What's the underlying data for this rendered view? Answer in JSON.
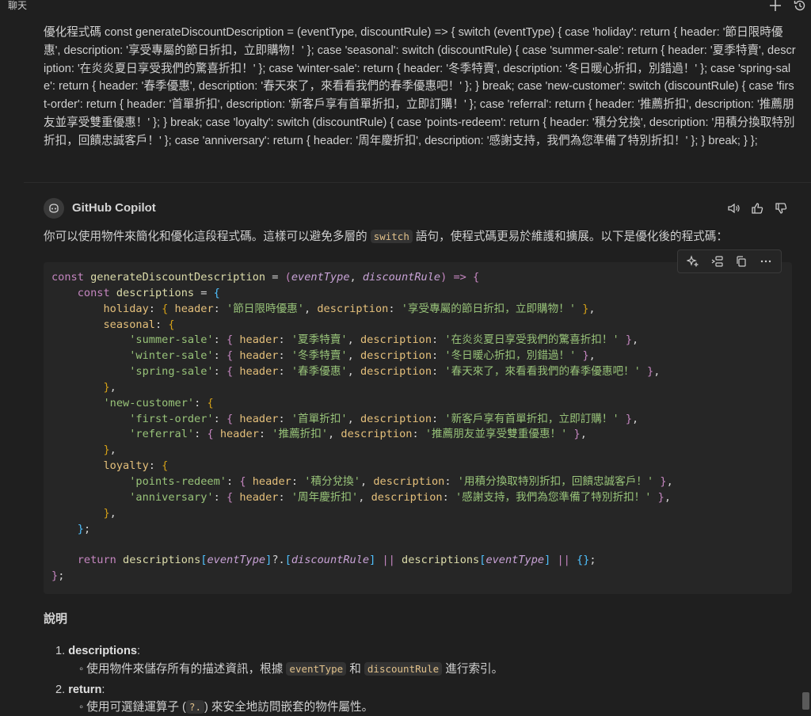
{
  "topbar": {
    "title": "聊天",
    "new_icon": "plus-icon",
    "history_icon": "history-icon"
  },
  "user_message": "優化程式碼 const generateDiscountDescription = (eventType, discountRule) => { switch (eventType) { case 'holiday': return { header: '節日限時優惠', description: '享受專屬的節日折扣，立即購物！' }; case 'seasonal': switch (discountRule) { case 'summer-sale': return { header: '夏季特賣', description: '在炎炎夏日享受我們的驚喜折扣！' }; case 'winter-sale': return { header: '冬季特賣', description: '冬日暖心折扣，別錯過！' }; case 'spring-sale': return { header: '春季優惠', description: '春天來了，來看看我們的春季優惠吧！' }; } break; case 'new-customer': switch (discountRule) { case 'first-order': return { header: '首單折扣', description: '新客戶享有首單折扣，立即訂購！' }; case 'referral': return { header: '推薦折扣', description: '推薦朋友並享受雙重優惠！' }; } break; case 'loyalty': switch (discountRule) { case 'points-redeem': return { header: '積分兌換', description: '用積分換取特別折扣，回饋忠誠客戶！' }; case 'anniversary': return { header: '周年慶折扣', description: '感謝支持，我們為您準備了特別折扣！' }; } break; } };",
  "bot": {
    "name": "GitHub Copilot",
    "icons": [
      "speaker-icon",
      "thumbs-up-icon",
      "thumbs-down-icon"
    ]
  },
  "intro": {
    "before": "你可以使用物件來簡化和優化這段程式碼。這樣可以避免多層的",
    "code": "switch",
    "after": "語句，使程式碼更易於維護和擴展。以下是優化後的程式碼："
  },
  "code_toolbar": [
    "sparkle-icon",
    "insert-icon",
    "copy-icon",
    "more-icon"
  ],
  "code": {
    "language": "javascript",
    "lines": [
      [
        [
          "kw",
          "const "
        ],
        [
          "fn",
          "generateDiscountDescription"
        ],
        [
          "pun",
          " = "
        ],
        [
          "brk2",
          "("
        ],
        [
          "param",
          "eventType"
        ],
        [
          "pun",
          ", "
        ],
        [
          "param",
          "discountRule"
        ],
        [
          "brk2",
          ")"
        ],
        [
          "pun",
          " "
        ],
        [
          "op",
          "=>"
        ],
        [
          "pun",
          " "
        ],
        [
          "brk2",
          "{"
        ]
      ],
      [
        [
          "pun",
          "    "
        ],
        [
          "kw",
          "const "
        ],
        [
          "var",
          "descriptions"
        ],
        [
          "pun",
          " = "
        ],
        [
          "brk3",
          "{"
        ]
      ],
      [
        [
          "pun",
          "        "
        ],
        [
          "prop",
          "holiday"
        ],
        [
          "pun",
          ": "
        ],
        [
          "brk",
          "{ "
        ],
        [
          "prop",
          "header"
        ],
        [
          "pun",
          ": "
        ],
        [
          "str",
          "'節日限時優惠'"
        ],
        [
          "pun",
          ", "
        ],
        [
          "prop",
          "description"
        ],
        [
          "pun",
          ": "
        ],
        [
          "str",
          "'享受專屬的節日折扣，立即購物！'"
        ],
        [
          "pun",
          " "
        ],
        [
          "brk",
          "}"
        ],
        [
          "pun",
          ","
        ]
      ],
      [
        [
          "pun",
          "        "
        ],
        [
          "prop",
          "seasonal"
        ],
        [
          "pun",
          ": "
        ],
        [
          "brk",
          "{"
        ]
      ],
      [
        [
          "pun",
          "            "
        ],
        [
          "str",
          "'summer-sale'"
        ],
        [
          "pun",
          ": "
        ],
        [
          "brk2",
          "{ "
        ],
        [
          "prop",
          "header"
        ],
        [
          "pun",
          ": "
        ],
        [
          "str",
          "'夏季特賣'"
        ],
        [
          "pun",
          ", "
        ],
        [
          "prop",
          "description"
        ],
        [
          "pun",
          ": "
        ],
        [
          "str",
          "'在炎炎夏日享受我們的驚喜折扣！'"
        ],
        [
          "pun",
          " "
        ],
        [
          "brk2",
          "}"
        ],
        [
          "pun",
          ","
        ]
      ],
      [
        [
          "pun",
          "            "
        ],
        [
          "str",
          "'winter-sale'"
        ],
        [
          "pun",
          ": "
        ],
        [
          "brk2",
          "{ "
        ],
        [
          "prop",
          "header"
        ],
        [
          "pun",
          ": "
        ],
        [
          "str",
          "'冬季特賣'"
        ],
        [
          "pun",
          ", "
        ],
        [
          "prop",
          "description"
        ],
        [
          "pun",
          ": "
        ],
        [
          "str",
          "'冬日暖心折扣，別錯過！'"
        ],
        [
          "pun",
          " "
        ],
        [
          "brk2",
          "}"
        ],
        [
          "pun",
          ","
        ]
      ],
      [
        [
          "pun",
          "            "
        ],
        [
          "str",
          "'spring-sale'"
        ],
        [
          "pun",
          ": "
        ],
        [
          "brk2",
          "{ "
        ],
        [
          "prop",
          "header"
        ],
        [
          "pun",
          ": "
        ],
        [
          "str",
          "'春季優惠'"
        ],
        [
          "pun",
          ", "
        ],
        [
          "prop",
          "description"
        ],
        [
          "pun",
          ": "
        ],
        [
          "str",
          "'春天來了，來看看我們的春季優惠吧！'"
        ],
        [
          "pun",
          " "
        ],
        [
          "brk2",
          "}"
        ],
        [
          "pun",
          ","
        ]
      ],
      [
        [
          "pun",
          "        "
        ],
        [
          "brk",
          "}"
        ],
        [
          "pun",
          ","
        ]
      ],
      [
        [
          "pun",
          "        "
        ],
        [
          "str",
          "'new-customer'"
        ],
        [
          "pun",
          ": "
        ],
        [
          "brk",
          "{"
        ]
      ],
      [
        [
          "pun",
          "            "
        ],
        [
          "str",
          "'first-order'"
        ],
        [
          "pun",
          ": "
        ],
        [
          "brk2",
          "{ "
        ],
        [
          "prop",
          "header"
        ],
        [
          "pun",
          ": "
        ],
        [
          "str",
          "'首單折扣'"
        ],
        [
          "pun",
          ", "
        ],
        [
          "prop",
          "description"
        ],
        [
          "pun",
          ": "
        ],
        [
          "str",
          "'新客戶享有首單折扣，立即訂購！'"
        ],
        [
          "pun",
          " "
        ],
        [
          "brk2",
          "}"
        ],
        [
          "pun",
          ","
        ]
      ],
      [
        [
          "pun",
          "            "
        ],
        [
          "str",
          "'referral'"
        ],
        [
          "pun",
          ": "
        ],
        [
          "brk2",
          "{ "
        ],
        [
          "prop",
          "header"
        ],
        [
          "pun",
          ": "
        ],
        [
          "str",
          "'推薦折扣'"
        ],
        [
          "pun",
          ", "
        ],
        [
          "prop",
          "description"
        ],
        [
          "pun",
          ": "
        ],
        [
          "str",
          "'推薦朋友並享受雙重優惠！'"
        ],
        [
          "pun",
          " "
        ],
        [
          "brk2",
          "}"
        ],
        [
          "pun",
          ","
        ]
      ],
      [
        [
          "pun",
          "        "
        ],
        [
          "brk",
          "}"
        ],
        [
          "pun",
          ","
        ]
      ],
      [
        [
          "pun",
          "        "
        ],
        [
          "prop",
          "loyalty"
        ],
        [
          "pun",
          ": "
        ],
        [
          "brk",
          "{"
        ]
      ],
      [
        [
          "pun",
          "            "
        ],
        [
          "str",
          "'points-redeem'"
        ],
        [
          "pun",
          ": "
        ],
        [
          "brk2",
          "{ "
        ],
        [
          "prop",
          "header"
        ],
        [
          "pun",
          ": "
        ],
        [
          "str",
          "'積分兌換'"
        ],
        [
          "pun",
          ", "
        ],
        [
          "prop",
          "description"
        ],
        [
          "pun",
          ": "
        ],
        [
          "str",
          "'用積分換取特別折扣，回饋忠誠客戶！'"
        ],
        [
          "pun",
          " "
        ],
        [
          "brk2",
          "}"
        ],
        [
          "pun",
          ","
        ]
      ],
      [
        [
          "pun",
          "            "
        ],
        [
          "str",
          "'anniversary'"
        ],
        [
          "pun",
          ": "
        ],
        [
          "brk2",
          "{ "
        ],
        [
          "prop",
          "header"
        ],
        [
          "pun",
          ": "
        ],
        [
          "str",
          "'周年慶折扣'"
        ],
        [
          "pun",
          ", "
        ],
        [
          "prop",
          "description"
        ],
        [
          "pun",
          ": "
        ],
        [
          "str",
          "'感謝支持，我們為您準備了特別折扣！'"
        ],
        [
          "pun",
          " "
        ],
        [
          "brk2",
          "}"
        ],
        [
          "pun",
          ","
        ]
      ],
      [
        [
          "pun",
          "        "
        ],
        [
          "brk",
          "}"
        ],
        [
          "pun",
          ","
        ]
      ],
      [
        [
          "pun",
          "    "
        ],
        [
          "brk3",
          "}"
        ],
        [
          "pun",
          ";"
        ]
      ],
      [
        [
          "pun",
          ""
        ]
      ],
      [
        [
          "pun",
          "    "
        ],
        [
          "kw",
          "return "
        ],
        [
          "var",
          "descriptions"
        ],
        [
          "brk3",
          "["
        ],
        [
          "param",
          "eventType"
        ],
        [
          "brk3",
          "]"
        ],
        [
          "pun",
          "?."
        ],
        [
          "brk3",
          "["
        ],
        [
          "param",
          "discountRule"
        ],
        [
          "brk3",
          "]"
        ],
        [
          "pun",
          " "
        ],
        [
          "op",
          "||"
        ],
        [
          "pun",
          " "
        ],
        [
          "var",
          "descriptions"
        ],
        [
          "brk3",
          "["
        ],
        [
          "param",
          "eventType"
        ],
        [
          "brk3",
          "]"
        ],
        [
          "pun",
          " "
        ],
        [
          "op",
          "||"
        ],
        [
          "pun",
          " "
        ],
        [
          "brk3",
          "{}"
        ],
        [
          "pun",
          ";"
        ]
      ],
      [
        [
          "brk2",
          "}"
        ],
        [
          "pun",
          ";"
        ]
      ]
    ]
  },
  "explanation": {
    "title": "說明",
    "items": [
      {
        "num": "1.",
        "term": "descriptions",
        "colon": ":",
        "sub": {
          "bullet": "◦",
          "before": "使用物件來儲存所有的描述資訊，根據",
          "code1": "eventType",
          "mid": "和",
          "code2": "discountRule",
          "after": "進行索引。"
        }
      },
      {
        "num": "2.",
        "term": "return",
        "colon": ":",
        "sub": {
          "bullet": "◦",
          "before": "使用可選鏈運算子 (",
          "code1": "?.",
          "after": ") 來安全地訪問嵌套的物件屬性。"
        }
      }
    ]
  }
}
